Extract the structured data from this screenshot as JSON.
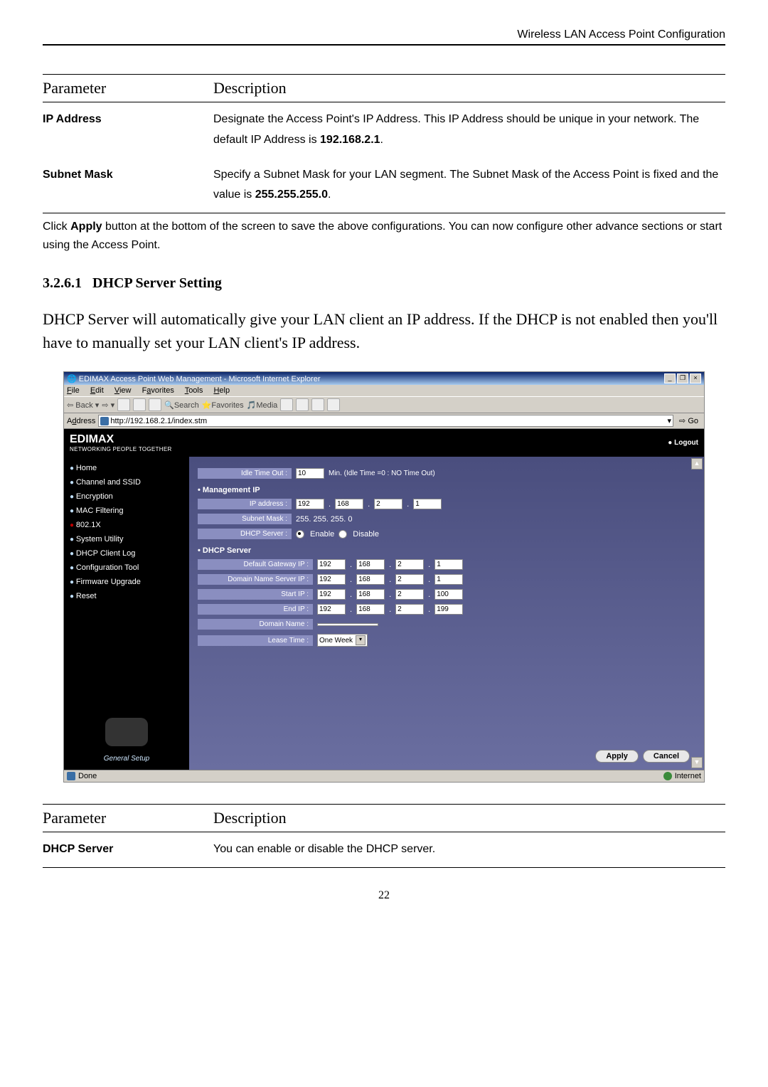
{
  "header": "Wireless LAN Access Point Configuration",
  "table1": {
    "col1": "Parameter",
    "col2": "Description",
    "rows": [
      {
        "p": "IP Address",
        "d": "Designate the Access Point's IP Address. This IP Address should be unique in your network. The default IP Address is 192.168.2.1."
      },
      {
        "p": "Subnet Mask",
        "d": "Specify a Subnet Mask for your LAN segment. The Subnet Mask of the Access Point is fixed and the value is 255.255.255.0."
      }
    ]
  },
  "apply_para": "Click Apply button at the bottom of the screen to save the above configurations. You can now configure other advance sections or start using the Access Point.",
  "section_num": "3.2.6.1",
  "section_title": "DHCP Server Setting",
  "section_para": "DHCP Server will automatically give your LAN client an IP address. If the DHCP is not enabled then you'll have to manually set your LAN client's IP address.",
  "ie": {
    "title": "EDIMAX Access Point Web Management - Microsoft Internet Explorer",
    "menus": [
      "File",
      "Edit",
      "View",
      "Favorites",
      "Tools",
      "Help"
    ],
    "toolbar": {
      "back": "Back",
      "search": "Search",
      "favorites": "Favorites",
      "media": "Media"
    },
    "address_label": "Address",
    "address": "http://192.168.2.1/index.stm",
    "go": "Go",
    "brand": "EDIMAX",
    "brand_sub": "NETWORKING PEOPLE TOGETHER",
    "logout": "Logout",
    "sidebar": [
      "Home",
      "Channel and SSID",
      "Encryption",
      "MAC Filtering",
      "802.1X",
      "System Utility",
      "DHCP Client Log",
      "Configuration Tool",
      "Firmware Upgrade",
      "Reset"
    ],
    "side_foot": "General Setup",
    "main": {
      "idle_label": "Idle Time Out :",
      "idle_value": "10",
      "idle_hint": "Min. (Idle Time =0 : NO Time Out)",
      "mgmt_h": "Management IP",
      "ip_label": "IP address :",
      "ip": [
        "192",
        "168",
        "2",
        "1"
      ],
      "mask_label": "Subnet Mask :",
      "mask": "255. 255. 255. 0",
      "dhcp_srv_label": "DHCP Server :",
      "enable": "Enable",
      "disable": "Disable",
      "dhcp_h": "DHCP Server",
      "gw_label": "Default Gateway IP :",
      "gw": [
        "192",
        "168",
        "2",
        "1"
      ],
      "dns_label": "Domain Name Server IP :",
      "dns": [
        "192",
        "168",
        "2",
        "1"
      ],
      "start_label": "Start IP :",
      "start": [
        "192",
        "168",
        "2",
        "100"
      ],
      "end_label": "End IP :",
      "end": [
        "192",
        "168",
        "2",
        "199"
      ],
      "domain_label": "Domain Name :",
      "domain": "",
      "lease_label": "Lease Time :",
      "lease": "One Week",
      "apply": "Apply",
      "cancel": "Cancel"
    },
    "status_left": "Done",
    "status_right": "Internet"
  },
  "table2": {
    "col1": "Parameter",
    "col2": "Description",
    "rows": [
      {
        "p": "DHCP Server",
        "d": "You can enable or disable the DHCP server."
      }
    ]
  },
  "page_num": "22"
}
